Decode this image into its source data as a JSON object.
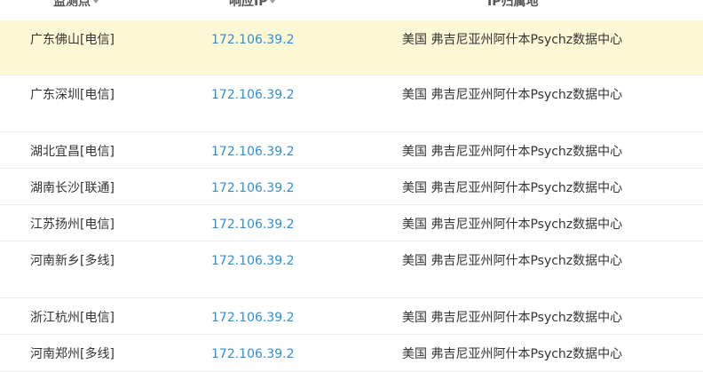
{
  "header": {
    "col_monitor": "监测点",
    "col_ip": "响应IP",
    "col_location": "IP归属地"
  },
  "rows": [
    {
      "point": "广东佛山[电信]",
      "ip": "172.106.39.2",
      "location": "美国 弗吉尼亚州阿什本Psychz数据中心"
    },
    {
      "point": "广东深圳[电信]",
      "ip": "172.106.39.2",
      "location": "美国 弗吉尼亚州阿什本Psychz数据中心"
    },
    {
      "point": "湖北宜昌[电信]",
      "ip": "172.106.39.2",
      "location": "美国 弗吉尼亚州阿什本Psychz数据中心"
    },
    {
      "point": "湖南长沙[联通]",
      "ip": "172.106.39.2",
      "location": "美国 弗吉尼亚州阿什本Psychz数据中心"
    },
    {
      "point": "江苏扬州[电信]",
      "ip": "172.106.39.2",
      "location": "美国 弗吉尼亚州阿什本Psychz数据中心"
    },
    {
      "point": "河南新乡[多线]",
      "ip": "172.106.39.2",
      "location": "美国 弗吉尼亚州阿什本Psychz数据中心"
    },
    {
      "point": "浙江杭州[电信]",
      "ip": "172.106.39.2",
      "location": "美国 弗吉尼亚州阿什本Psychz数据中心"
    },
    {
      "point": "河南郑州[多线]",
      "ip": "172.106.39.2",
      "location": "美国 弗吉尼亚州阿什本Psychz数据中心"
    }
  ]
}
